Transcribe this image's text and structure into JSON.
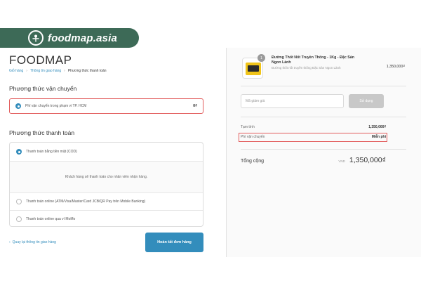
{
  "brand": {
    "site": "foodmap.asia"
  },
  "checkout": {
    "store_name": "FOODMAP",
    "breadcrumb": [
      "Giỏ hàng",
      "Thông tin giao hàng",
      "Phương thức thanh toán"
    ],
    "shipping": {
      "title": "Phương thức vận chuyển",
      "option_label": "Phí vận chuyển trong phạm vi TP. HCM",
      "option_price": "0₫"
    },
    "payment": {
      "title": "Phương thức thanh toán",
      "options": [
        "Thanh toán bằng tiền mặt (COD)",
        "Thanh toán online (ATM/Visa/Master/Card JCB/QR Pay trên Mobile Banking)",
        "Thanh toán online qua ví MoMo"
      ],
      "cod_description": "Khách hàng sẽ thanh toán cho nhân viên nhận hàng."
    },
    "return_link": "Quay lại thông tin giao hàng",
    "finish_button": "Hoàn tất đơn hàng"
  },
  "summary": {
    "product": {
      "qty": "1",
      "name": "Đường Thốt Nốt Truyền Thống - 1Kg - Đặc Sản Ngon Lành",
      "desc": "Đường thốt nốt truyền thống Đặc Sản Ngon Lành",
      "price": "1,350,000₫"
    },
    "discount_placeholder": "Mã giảm giá",
    "apply_button": "Sử dụng",
    "subtotal_label": "Tạm tính",
    "subtotal_value": "1,350,000₫",
    "shipping_label": "Phí vận chuyển",
    "shipping_value": "Miễn phí",
    "total_label": "Tổng cộng",
    "total_currency": "VND",
    "total_value": "1,350,000₫"
  },
  "colors": {
    "brand_green": "#3d6a57",
    "accent_blue": "#338dbc",
    "highlight_red": "#e25c5c"
  }
}
